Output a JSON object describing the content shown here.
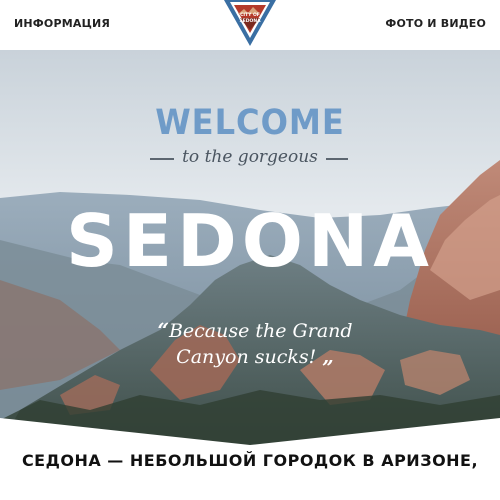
{
  "nav": {
    "left_label": "ИНФОРМАЦИЯ",
    "right_label": "ФОТО И ВИДЕО",
    "logo_text": "CITY OF SEDONA",
    "logo_icon": "city-seal-icon"
  },
  "hero": {
    "welcome": "WELCOME",
    "tagline": "to the gorgeous",
    "title": "SEDONA",
    "quote_open": "“",
    "quote_line1": "Because the Grand",
    "quote_line2": "Canyon sucks!",
    "quote_close": "„"
  },
  "content": {
    "headline": "СЕДОНА — НЕБОЛЬШОЙ ГОРОДОК В АРИЗОНЕ,"
  },
  "colors": {
    "welcome": "#6f9bc8",
    "logo_blue": "#3a6fa3",
    "logo_red": "#b43a2a",
    "sky": "#dfe6ec"
  }
}
